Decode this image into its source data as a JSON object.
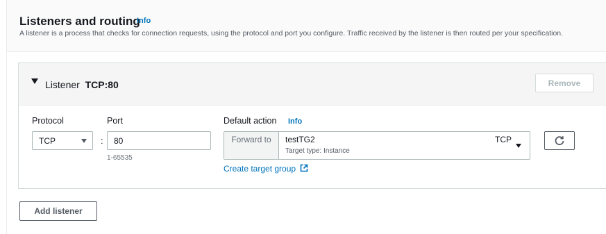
{
  "section": {
    "title": "Listeners and routing",
    "info": "Info",
    "description": "A listener is a process that checks for connection requests, using the protocol and port you configure. Traffic received by the listener is then routed per your specification."
  },
  "listener": {
    "label": "Listener",
    "value": "TCP:80",
    "remove_label": "Remove",
    "protocol": {
      "label": "Protocol",
      "selected": "TCP"
    },
    "port": {
      "label": "Port",
      "value": "80",
      "hint": "1-65535"
    },
    "default_action": {
      "label": "Default action",
      "info": "Info",
      "forward_label": "Forward to",
      "target_group": "testTG2",
      "target_type": "Target type: Instance",
      "target_protocol": "TCP",
      "create_link": "Create target group"
    }
  },
  "add_listener_label": "Add listener",
  "colors": {
    "link": "#0073bb",
    "border": "#aab7b8",
    "text": "#16191f"
  },
  "icons": [
    "caret-down-icon",
    "dropdown-arrow-icon",
    "refresh-icon",
    "external-link-icon"
  ]
}
